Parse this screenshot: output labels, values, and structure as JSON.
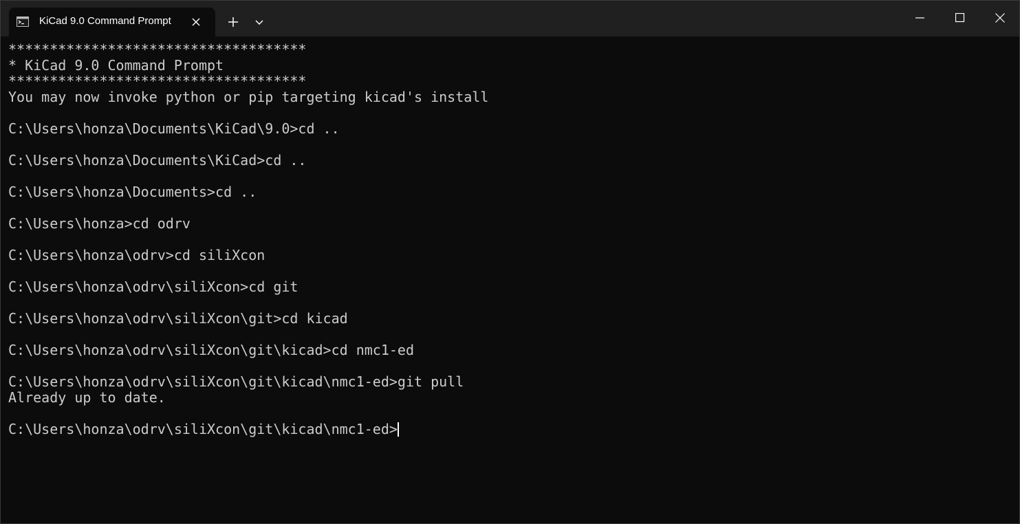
{
  "window": {
    "tab_title": "KiCad 9.0 Command Prompt",
    "tab_icon": "cmd-terminal-icon",
    "buttons": {
      "close_tab": "close-icon",
      "new_tab": "plus-icon",
      "tab_menu": "chevron-down-icon",
      "minimize": "minimize-icon",
      "maximize": "maximize-icon",
      "close": "close-icon"
    }
  },
  "terminal": {
    "lines": [
      "************************************",
      "* KiCad 9.0 Command Prompt",
      "************************************",
      "You may now invoke python or pip targeting kicad's install",
      "",
      "C:\\Users\\honza\\Documents\\KiCad\\9.0>cd ..",
      "",
      "C:\\Users\\honza\\Documents\\KiCad>cd ..",
      "",
      "C:\\Users\\honza\\Documents>cd ..",
      "",
      "C:\\Users\\honza>cd odrv",
      "",
      "C:\\Users\\honza\\odrv>cd siliXcon",
      "",
      "C:\\Users\\honza\\odrv\\siliXcon>cd git",
      "",
      "C:\\Users\\honza\\odrv\\siliXcon\\git>cd kicad",
      "",
      "C:\\Users\\honza\\odrv\\siliXcon\\git\\kicad>cd nmc1-ed",
      "",
      "C:\\Users\\honza\\odrv\\siliXcon\\git\\kicad\\nmc1-ed>git pull",
      "Already up to date.",
      ""
    ],
    "prompt": "C:\\Users\\honza\\odrv\\siliXcon\\git\\kicad\\nmc1-ed>"
  },
  "colors": {
    "background": "#0c0c0c",
    "titlebar": "#202020",
    "text": "#cccccc",
    "cursor": "#ffffff"
  }
}
